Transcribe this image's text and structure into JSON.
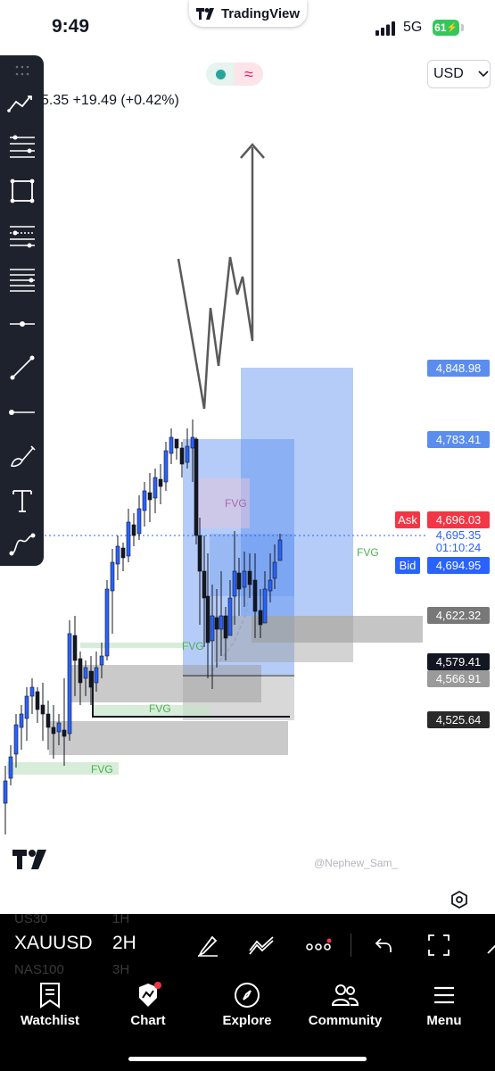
{
  "status_bar": {
    "time": "9:49",
    "network": "5G",
    "battery": "61"
  },
  "app": {
    "name": "TradingView",
    "watermark": "@Nephew_Sam_"
  },
  "chart_header": {
    "price_change": "5.35  +19.49 (+0.42%)",
    "currency": "USD"
  },
  "price_scale": {
    "labels": [
      "4,848.98",
      "4,783.41",
      "4,622.32",
      "4,579.41",
      "4,566.91",
      "4,525.64"
    ],
    "ask_label": "Ask",
    "ask_price": "4,696.03",
    "last_price": "4,695.35",
    "countdown": "01:10:24",
    "bid_label": "Bid",
    "bid_price": "4,694.95"
  },
  "annotations": {
    "fvg_labels": [
      "FVG",
      "FVG",
      "FVG",
      "FVG",
      "FVG"
    ]
  },
  "drawing_tools": [
    "trend-angle",
    "fib-retracement",
    "rectangle",
    "pitchfork",
    "parallel-channel",
    "horizontal-ray",
    "trend-line",
    "horizontal-line",
    "brush",
    "text",
    "path"
  ],
  "symbol_bar": {
    "symbol": "XAUUSD",
    "interval": "2H",
    "prev_symbol": "US30",
    "prev_interval": "1H",
    "next_symbol": "NAS100",
    "next_interval": "3H"
  },
  "tab_bar": {
    "tabs": [
      {
        "label": "Watchlist",
        "icon": "bookmark-icon"
      },
      {
        "label": "Chart",
        "icon": "chart-icon"
      },
      {
        "label": "Explore",
        "icon": "compass-icon"
      },
      {
        "label": "Community",
        "icon": "people-icon"
      },
      {
        "label": "Menu",
        "icon": "menu-icon"
      }
    ]
  },
  "colors": {
    "up": "#2962ff",
    "down": "#131722",
    "ask": "#f23645",
    "bid": "#2962ff",
    "zone_blue": "#5b8def",
    "zone_gray": "#9e9e9e",
    "fvg_green": "#4caf50"
  }
}
